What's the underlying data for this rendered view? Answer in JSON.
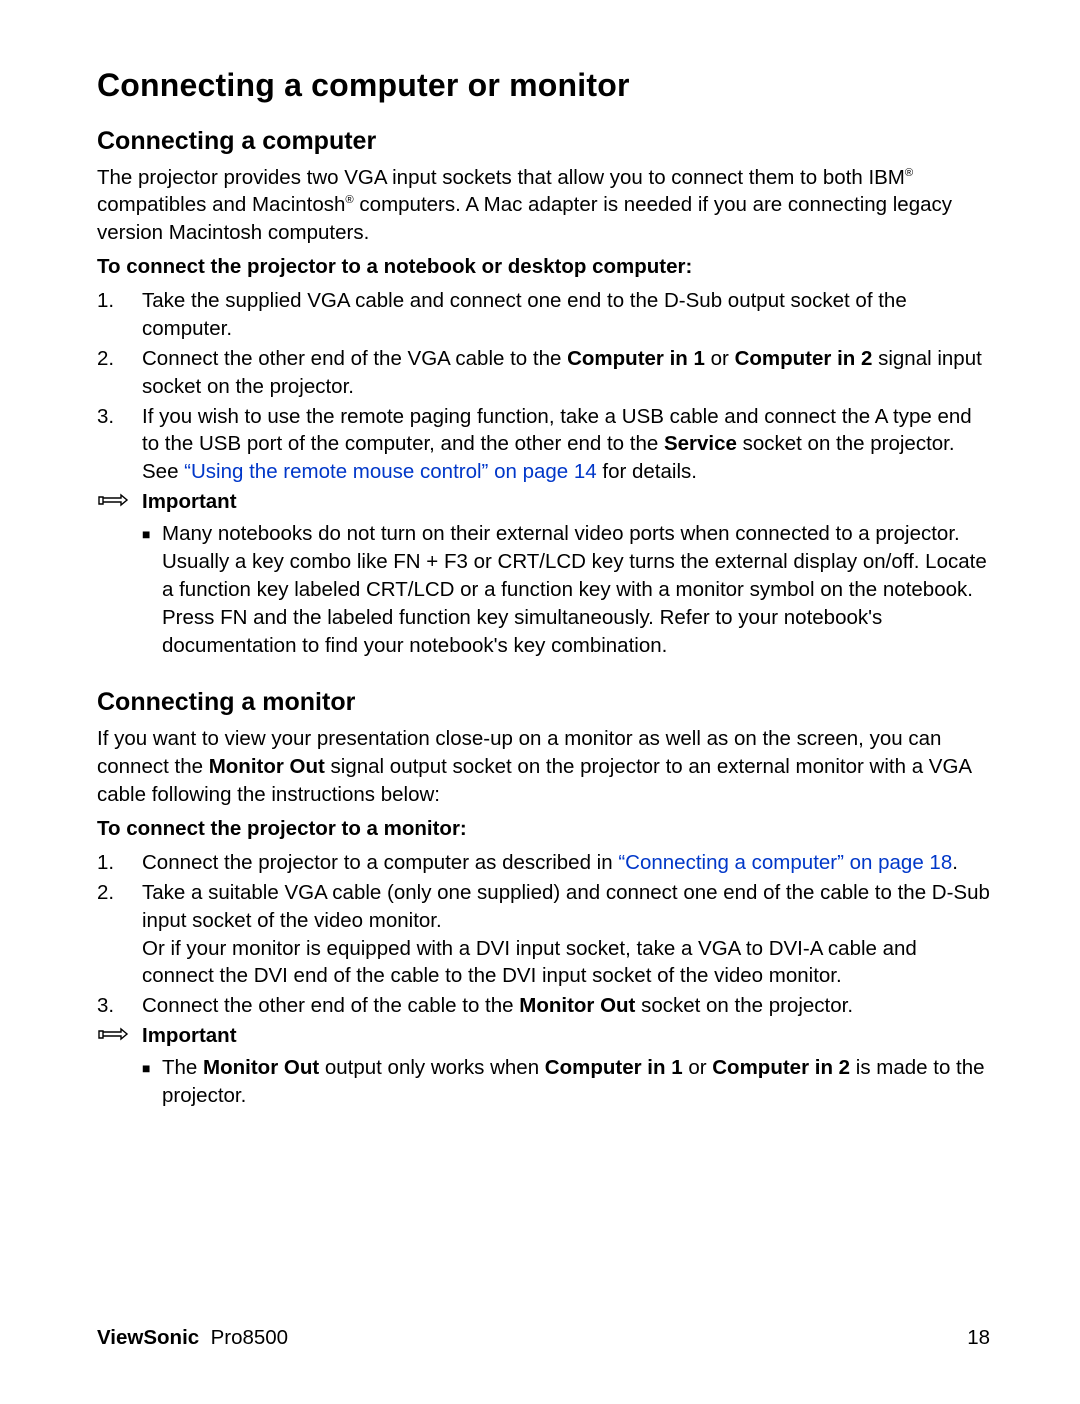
{
  "heading_main": "Connecting a computer or monitor",
  "sec1": {
    "heading": "Connecting a computer",
    "p1_a": "The projector provides two VGA input sockets that allow you to connect them to both IBM",
    "p1_b": " compatibles and Macintosh",
    "p1_c": " computers. A Mac adapter is needed if you are connecting legacy version Macintosh computers.",
    "sub": "To connect the projector to a notebook or desktop computer:",
    "li1": "Take the supplied VGA cable and connect one end to the D-Sub output socket of the computer.",
    "li2_a": "Connect the other end of the VGA cable to the ",
    "li2_b1": "Computer in 1",
    "li2_mid": " or ",
    "li2_b2": "Computer in 2",
    "li2_c": " signal input socket on the projector.",
    "li3_a": "If you wish to use the remote paging function, take a USB cable and connect the A type end to the USB port of the computer, and the other end to the ",
    "li3_b": "Service",
    "li3_c": " socket on the projector. See ",
    "li3_link": "“Using the remote mouse control” on page 14",
    "li3_d": " for details.",
    "note_title": "Important",
    "note_bullet": "Many notebooks do not turn on their external video ports when connected to a projector. Usually a key combo like FN + F3 or CRT/LCD key turns the external display on/off. Locate a function key labeled CRT/LCD or a function key with a monitor symbol on the notebook. Press FN and the labeled function key simultaneously. Refer to your notebook's documentation to find your notebook's key combination."
  },
  "sec2": {
    "heading": "Connecting a monitor",
    "p1_a": "If you want to view your presentation close-up on a monitor as well as on the screen, you can connect the ",
    "p1_b": "Monitor Out",
    "p1_c": " signal output socket on the projector to an external monitor with a VGA cable following the instructions below:",
    "sub": "To connect the projector to a monitor:",
    "li1_a": "Connect the projector to a computer as described in ",
    "li1_link": "“Connecting a computer” on page 18",
    "li1_b": ".",
    "li2": "Take a suitable VGA cable (only one supplied) and connect one end of the cable to the  D-Sub input socket of the video monitor.",
    "li2b": "Or if your monitor is equipped with a DVI input socket, take a VGA to DVI-A cable and connect the DVI end of the cable to the DVI input socket of the video monitor.",
    "li3_a": "Connect the other end of the cable to the ",
    "li3_b": "Monitor Out",
    "li3_c": " socket on the projector.",
    "note_title": "Important",
    "note_bullet_a": "The ",
    "note_bullet_b1": "Monitor Out",
    "note_bullet_mid1": " output only works when ",
    "note_bullet_b2": "Computer in 1",
    "note_bullet_mid2": " or ",
    "note_bullet_b3": "Computer in 2",
    "note_bullet_c": " is made to the projector."
  },
  "footer": {
    "brand": "ViewSonic",
    "model": "Pro8500",
    "page": "18"
  },
  "labels": {
    "n1": "1.",
    "n2": "2.",
    "n3": "3.",
    "reg": "®",
    "square": "■"
  }
}
